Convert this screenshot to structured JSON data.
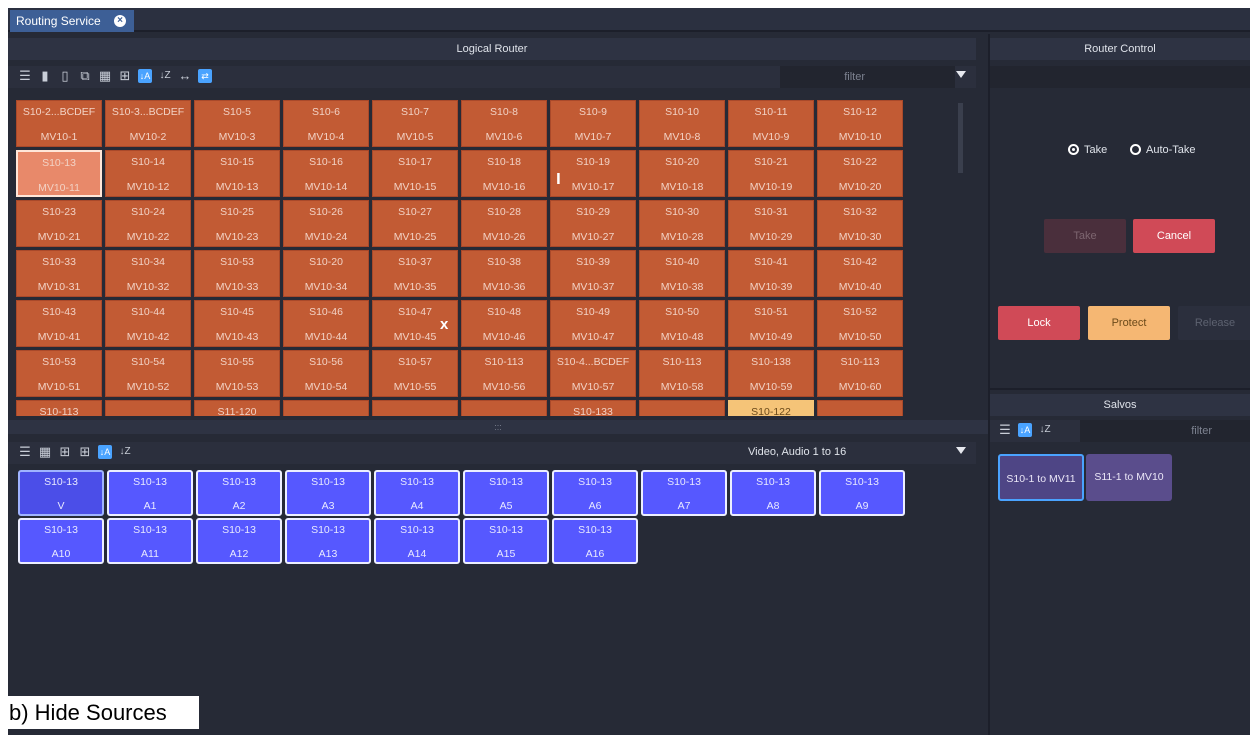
{
  "window": {
    "tab_title": "Routing Service"
  },
  "logical_router": {
    "title": "Logical Router",
    "filter_placeholder": "filter",
    "rows": [
      [
        [
          "S10-2...BCDEF",
          "MV10-1"
        ],
        [
          "S10-3...BCDEF",
          "MV10-2"
        ],
        [
          "S10-5",
          "MV10-3"
        ],
        [
          "S10-6",
          "MV10-4"
        ],
        [
          "S10-7",
          "MV10-5"
        ],
        [
          "S10-8",
          "MV10-6"
        ],
        [
          "S10-9",
          "MV10-7"
        ],
        [
          "S10-10",
          "MV10-8"
        ],
        [
          "S10-11",
          "MV10-9"
        ],
        [
          "S10-12",
          "MV10-10"
        ]
      ],
      [
        [
          "S10-13",
          "MV10-11"
        ],
        [
          "S10-14",
          "MV10-12"
        ],
        [
          "S10-15",
          "MV10-13"
        ],
        [
          "S10-16",
          "MV10-14"
        ],
        [
          "S10-17",
          "MV10-15"
        ],
        [
          "S10-18",
          "MV10-16"
        ],
        [
          "S10-19",
          "MV10-17"
        ],
        [
          "S10-20",
          "MV10-18"
        ],
        [
          "S10-21",
          "MV10-19"
        ],
        [
          "S10-22",
          "MV10-20"
        ]
      ],
      [
        [
          "S10-23",
          "MV10-21"
        ],
        [
          "S10-24",
          "MV10-22"
        ],
        [
          "S10-25",
          "MV10-23"
        ],
        [
          "S10-26",
          "MV10-24"
        ],
        [
          "S10-27",
          "MV10-25"
        ],
        [
          "S10-28",
          "MV10-26"
        ],
        [
          "S10-29",
          "MV10-27"
        ],
        [
          "S10-30",
          "MV10-28"
        ],
        [
          "S10-31",
          "MV10-29"
        ],
        [
          "S10-32",
          "MV10-30"
        ]
      ],
      [
        [
          "S10-33",
          "MV10-31"
        ],
        [
          "S10-34",
          "MV10-32"
        ],
        [
          "S10-53",
          "MV10-33"
        ],
        [
          "S10-20",
          "MV10-34"
        ],
        [
          "S10-37",
          "MV10-35"
        ],
        [
          "S10-38",
          "MV10-36"
        ],
        [
          "S10-39",
          "MV10-37"
        ],
        [
          "S10-40",
          "MV10-38"
        ],
        [
          "S10-41",
          "MV10-39"
        ],
        [
          "S10-42",
          "MV10-40"
        ]
      ],
      [
        [
          "S10-43",
          "MV10-41"
        ],
        [
          "S10-44",
          "MV10-42"
        ],
        [
          "S10-45",
          "MV10-43"
        ],
        [
          "S10-46",
          "MV10-44"
        ],
        [
          "S10-47",
          "MV10-45"
        ],
        [
          "S10-48",
          "MV10-46"
        ],
        [
          "S10-49",
          "MV10-47"
        ],
        [
          "S10-50",
          "MV10-48"
        ],
        [
          "S10-51",
          "MV10-49"
        ],
        [
          "S10-52",
          "MV10-50"
        ]
      ],
      [
        [
          "S10-53",
          "MV10-51"
        ],
        [
          "S10-54",
          "MV10-52"
        ],
        [
          "S10-55",
          "MV10-53"
        ],
        [
          "S10-56",
          "MV10-54"
        ],
        [
          "S10-57",
          "MV10-55"
        ],
        [
          "S10-113",
          "MV10-56"
        ],
        [
          "S10-4...BCDEF",
          "MV10-57"
        ],
        [
          "S10-113",
          "MV10-58"
        ],
        [
          "S10-138",
          "MV10-59"
        ],
        [
          "S10-113",
          "MV10-60"
        ]
      ],
      [
        [
          "S10-113",
          ""
        ],
        [
          "",
          ""
        ],
        [
          "S11-120",
          ""
        ],
        [
          "",
          ""
        ],
        [
          "",
          ""
        ],
        [
          "",
          ""
        ],
        [
          "S10-133",
          ""
        ],
        [
          "",
          ""
        ],
        [
          "S10-122",
          ""
        ],
        [
          "",
          ""
        ]
      ]
    ],
    "selected": "S10-13/MV10-11",
    "highlighted": "S10-122"
  },
  "levels": {
    "filter_label": "Video, Audio 1 to 16",
    "rows": [
      [
        [
          "S10-13",
          "V"
        ],
        [
          "S10-13",
          "A1"
        ],
        [
          "S10-13",
          "A2"
        ],
        [
          "S10-13",
          "A3"
        ],
        [
          "S10-13",
          "A4"
        ],
        [
          "S10-13",
          "A5"
        ],
        [
          "S10-13",
          "A6"
        ],
        [
          "S10-13",
          "A7"
        ],
        [
          "S10-13",
          "A8"
        ],
        [
          "S10-13",
          "A9"
        ]
      ],
      [
        [
          "S10-13",
          "A10"
        ],
        [
          "S10-13",
          "A11"
        ],
        [
          "S10-13",
          "A12"
        ],
        [
          "S10-13",
          "A13"
        ],
        [
          "S10-13",
          "A14"
        ],
        [
          "S10-13",
          "A15"
        ],
        [
          "S10-13",
          "A16"
        ]
      ]
    ]
  },
  "router_control": {
    "title": "Router Control",
    "take_radio": "Take",
    "auto_take_radio": "Auto-Take",
    "take_button": "Take",
    "cancel_button": "Cancel",
    "lock_button": "Lock",
    "protect_button": "Protect",
    "release_button": "Release"
  },
  "salvos": {
    "title": "Salvos",
    "filter_placeholder": "filter",
    "items": [
      "S10-1 to MV11",
      "S11-1 to MV10"
    ]
  },
  "caption": "b) Hide Sources",
  "colors": {
    "background": "#262a36",
    "crosspoint_orange": "#c25b34",
    "level_blue": "#5658ff",
    "cancel_red": "#d04a57",
    "protect_orange": "#f5b773",
    "salvo_purple": "#5a4d8c"
  }
}
